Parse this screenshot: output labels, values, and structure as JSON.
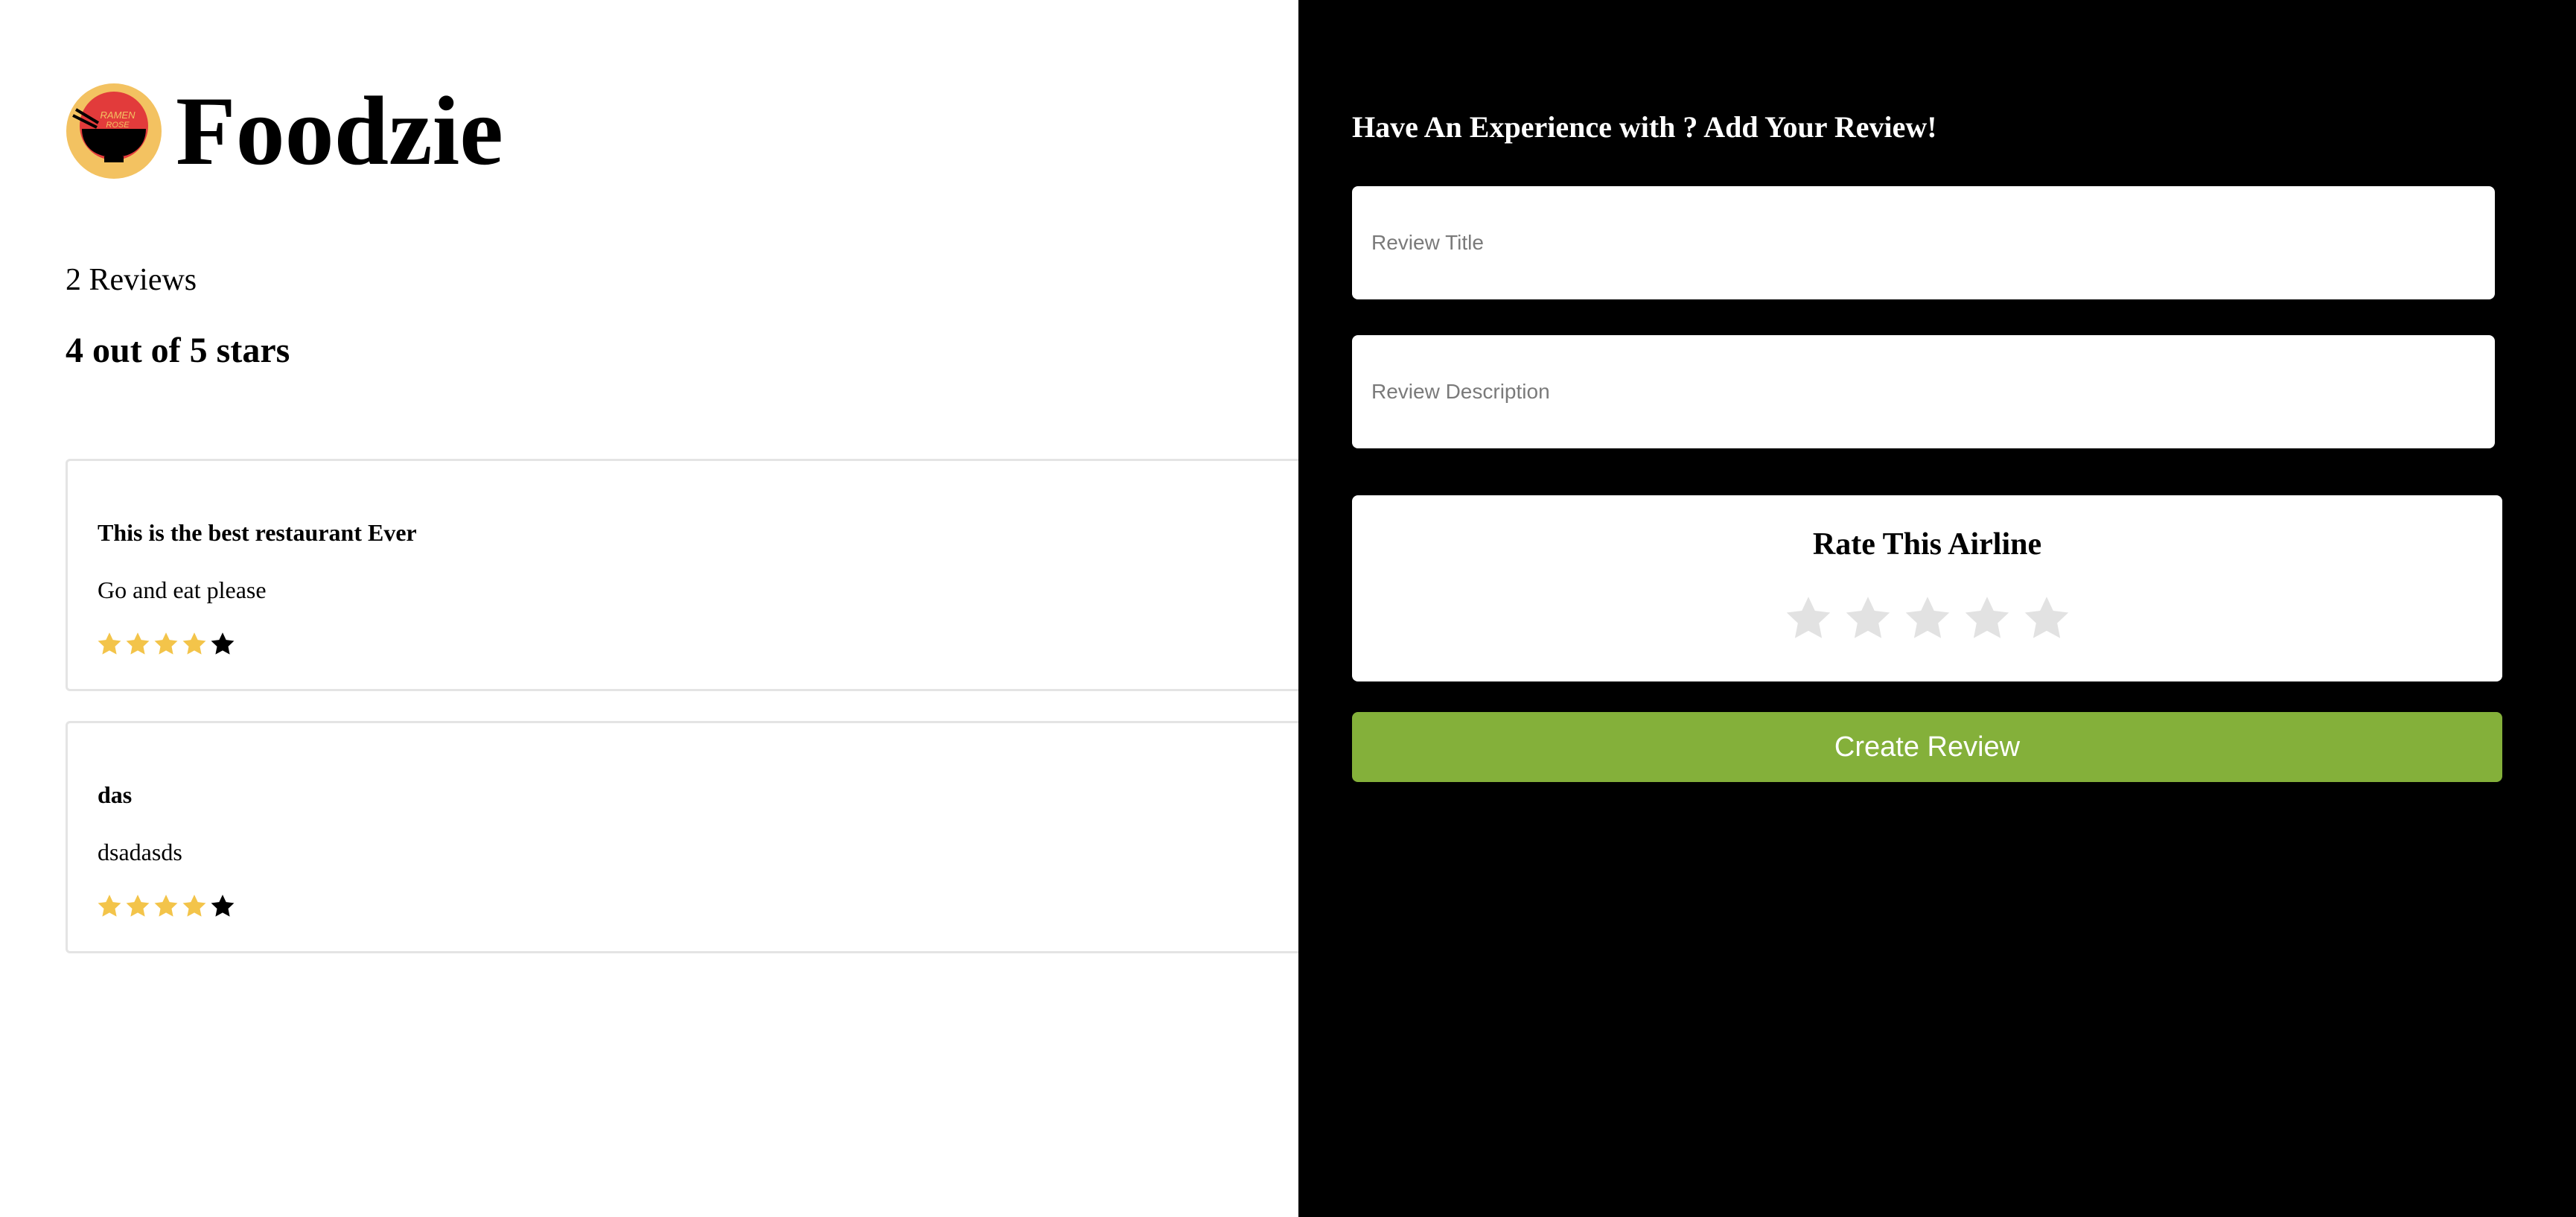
{
  "brand": {
    "name": "Foodzie",
    "logo_text_line1": "RAMEN",
    "logo_text_line2": "ROSE",
    "logo_colors": {
      "ring": "#f3c261",
      "disc": "#e23b3b",
      "bowl": "#000000"
    }
  },
  "summary": {
    "review_count_text": "2 Reviews",
    "average_text": "4 out of 5 stars"
  },
  "reviews": [
    {
      "title": "This is the best restaurant Ever",
      "description": "Go and eat please",
      "rating": 4,
      "max_rating": 5
    },
    {
      "title": "das",
      "description": "dsadasds",
      "rating": 4,
      "max_rating": 5
    }
  ],
  "form": {
    "heading": "Have An Experience with ? Add Your Review!",
    "title_placeholder": "Review Title",
    "title_value": "",
    "description_placeholder": "Review Description",
    "description_value": "",
    "rating_label": "Rate This Airline",
    "rating_value": 0,
    "rating_max": 5,
    "submit_label": "Create Review"
  },
  "colors": {
    "star_filled": "#f3c44a",
    "star_empty_review": "#000000",
    "star_empty_form": "#e2e2e2",
    "submit_bg": "#84b03a",
    "panel_bg": "#000000"
  }
}
